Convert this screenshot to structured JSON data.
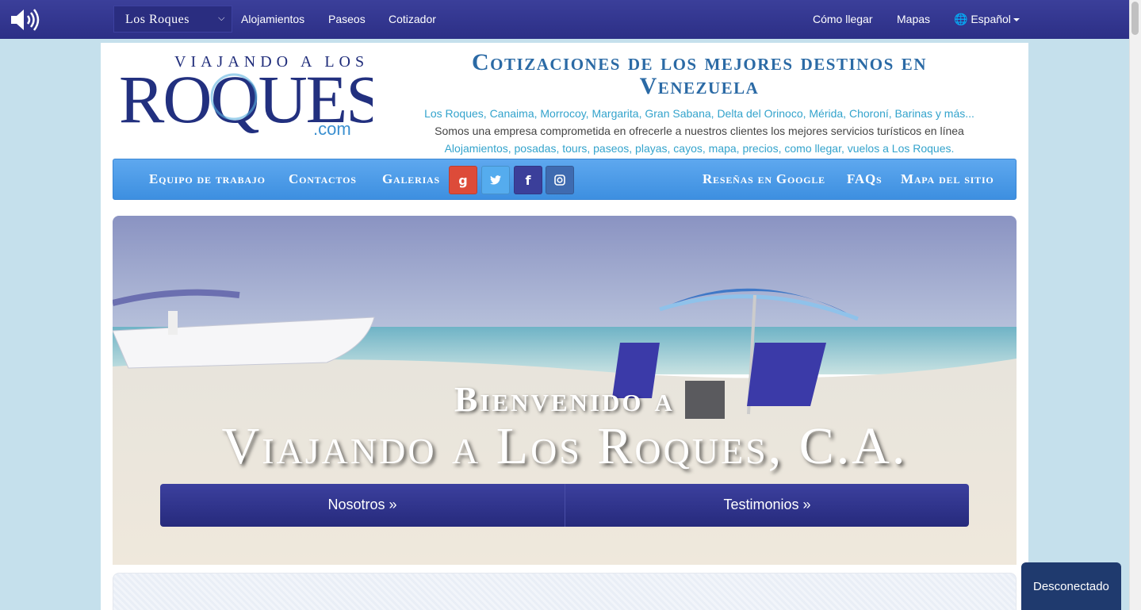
{
  "topbar": {
    "destination": "Los Roques",
    "nav_left": [
      "Alojamientos",
      "Paseos",
      "Cotizador"
    ],
    "nav_right": [
      "Cómo llegar",
      "Mapas"
    ],
    "language": "Español"
  },
  "header": {
    "logo_small": "VIAJANDO A LOS",
    "logo_main": "ROQUES",
    "logo_tld": ".com",
    "headline": "Cotizaciones de los mejores destinos en Venezuela",
    "destinations_line": "Los Roques, Canaima, Morrocoy, Margarita, Gran Sabana, Delta del Orinoco, Mérida, Choroní, Barinas y más...",
    "company_line": "Somos una empresa comprometida en ofrecerle a nuestros clientes los mejores servicios turísticos en línea",
    "services_line": "Alojamientos, posadas, tours, paseos, playas, cayos, mapa, precios, como llegar, vuelos a Los Roques."
  },
  "bluenav": {
    "left": [
      "Equipo de trabajo",
      "Contactos",
      "Galerias"
    ],
    "right": [
      "Reseñas en Google",
      "FAQs",
      "Mapa del sitio"
    ],
    "social": [
      "google-plus-icon",
      "twitter-icon",
      "facebook-icon",
      "instagram-icon"
    ]
  },
  "hero": {
    "welcome": "Bienvenido a",
    "company": "Viajando a Los Roques, C.A.",
    "btn_about": "Nosotros »",
    "btn_testimonials": "Testimonios »"
  },
  "status": "Desconectado",
  "colors": {
    "topbar": "#2c2f86",
    "bluenav": "#4a97e6",
    "headline": "#2b6aa5",
    "link": "#33a3cc",
    "google": "#dd4b39",
    "twitter": "#55acee",
    "facebook": "#3b3f9a",
    "instagram": "#3f6bb0"
  }
}
